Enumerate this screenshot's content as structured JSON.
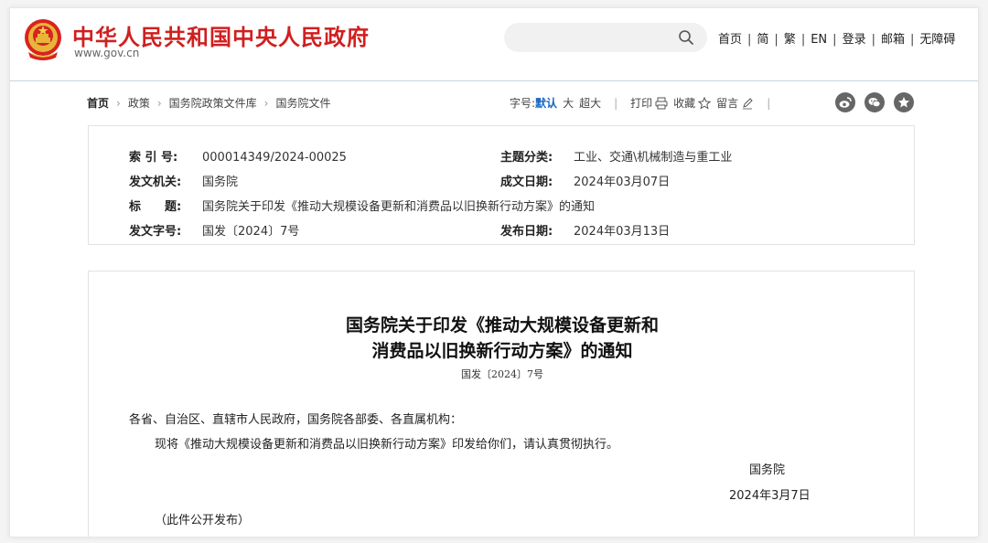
{
  "header": {
    "site_title": "中华人民共和国中央人民政府",
    "site_url": "www.gov.cn",
    "search_placeholder": "",
    "nav": [
      "首页",
      "简",
      "繁",
      "EN",
      "登录",
      "邮箱",
      "无障碍"
    ]
  },
  "breadcrumb": [
    "首页",
    "政策",
    "国务院政策文件库",
    "国务院文件"
  ],
  "toolbar": {
    "font_size_label": "字号:",
    "font_default": "默认",
    "font_large": "大",
    "font_xlarge": "超大",
    "print": "打印",
    "favorite": "收藏",
    "comment": "留言"
  },
  "info": {
    "index_label": "索 引 号:",
    "index_value": "000014349/2024-00025",
    "category_label": "主题分类:",
    "category_value": "工业、交通\\机械制造与重工业",
    "issuer_label": "发文机关:",
    "issuer_value": "国务院",
    "written_label": "成文日期:",
    "written_value": "2024年03月07日",
    "title_label": "标　　题:",
    "title_value": "国务院关于印发《推动大规模设备更新和消费品以旧换新行动方案》的通知",
    "docno_label": "发文字号:",
    "docno_value": "国发〔2024〕7号",
    "published_label": "发布日期:",
    "published_value": "2024年03月13日"
  },
  "document": {
    "title_line1": "国务院关于印发《推动大规模设备更新和",
    "title_line2": "消费品以旧换新行动方案》的通知",
    "number": "国发〔2024〕7号",
    "salutation": "各省、自治区、直辖市人民政府，国务院各部委、各直属机构：",
    "body": "现将《推动大规模设备更新和消费品以旧换新行动方案》印发给你们，请认真贯彻执行。",
    "signer": "国务院",
    "date": "2024年3月7日",
    "note": "（此件公开发布）"
  },
  "colors": {
    "brand_red": "#d01f1f",
    "active_blue": "#1565c0",
    "social_grey": "#666666"
  },
  "icons": [
    "national-emblem-icon",
    "search-icon",
    "printer-icon",
    "star-icon",
    "pen-icon",
    "weibo-icon",
    "wechat-icon",
    "favorite-star-icon"
  ]
}
